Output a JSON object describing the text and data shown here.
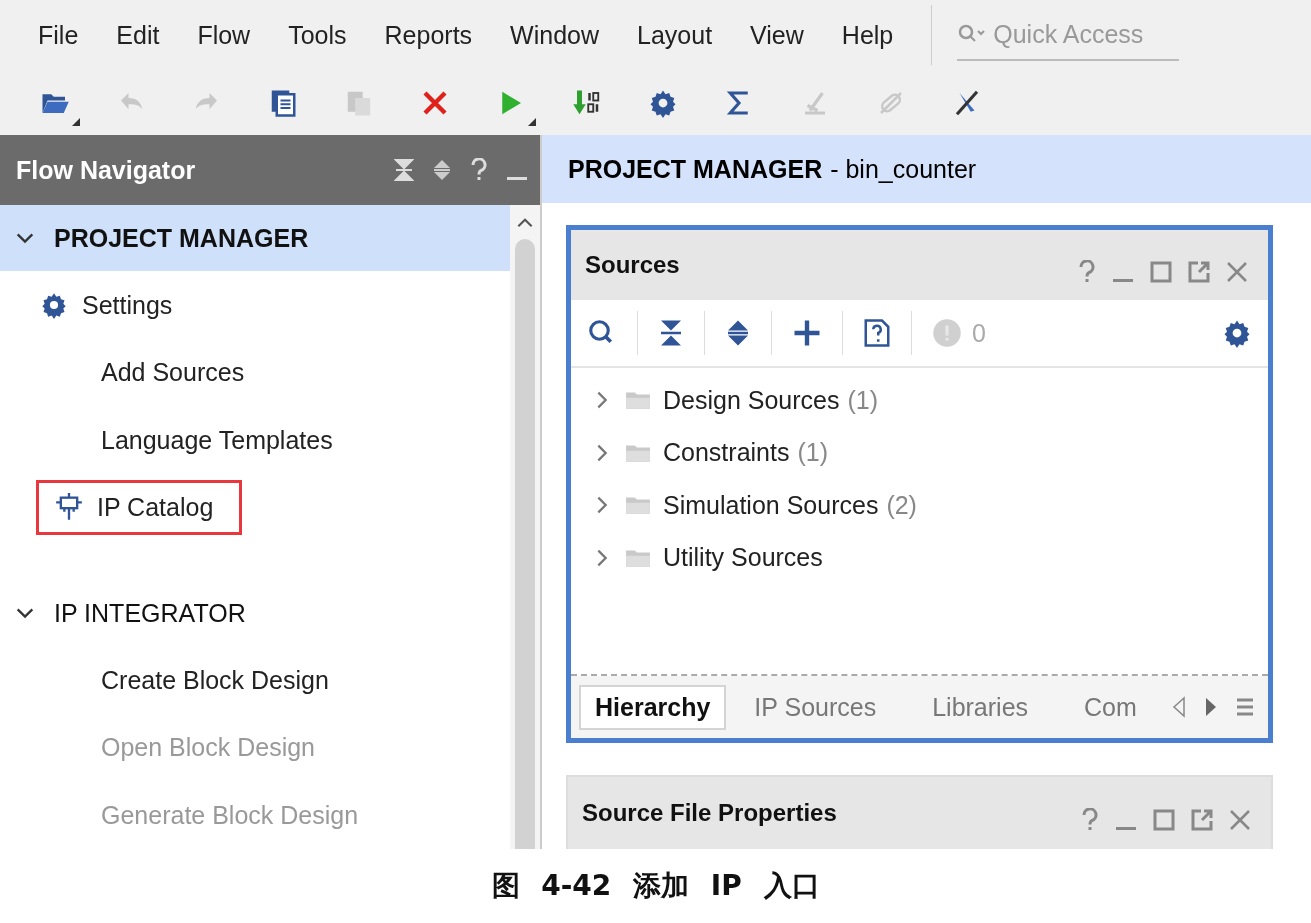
{
  "menu": [
    {
      "label": "File"
    },
    {
      "label": "Edit"
    },
    {
      "label": "Flow"
    },
    {
      "label": "Tools"
    },
    {
      "label": "Reports"
    },
    {
      "label": "Window"
    },
    {
      "label": "Layout"
    },
    {
      "label": "View"
    },
    {
      "label": "Help"
    }
  ],
  "quick_access": {
    "placeholder": "Quick Access"
  },
  "toolbar": [
    {
      "kind": "open",
      "disabled": false,
      "dropdown": true
    },
    {
      "kind": "undo",
      "disabled": true
    },
    {
      "kind": "redo",
      "disabled": true
    },
    {
      "kind": "report",
      "disabled": false
    },
    {
      "kind": "paste",
      "disabled": true
    },
    {
      "kind": "stop",
      "disabled": false
    },
    {
      "kind": "run",
      "disabled": false,
      "dropdown": true
    },
    {
      "kind": "bitstream",
      "disabled": false
    },
    {
      "kind": "settings",
      "disabled": false
    },
    {
      "kind": "sigma",
      "disabled": false
    },
    {
      "kind": "probe",
      "disabled": true
    },
    {
      "kind": "link",
      "disabled": true
    },
    {
      "kind": "tool",
      "disabled": false
    }
  ],
  "flow_navigator": {
    "title": "Flow Navigator",
    "sections": [
      {
        "label": "PROJECT MANAGER",
        "expanded": true,
        "selected": true,
        "bold": true,
        "children": [
          {
            "label": "Settings",
            "kind": "gear",
            "disabled": false,
            "highlighted": false
          },
          {
            "label": "Add Sources",
            "disabled": false,
            "highlighted": false
          },
          {
            "label": "Language Templates",
            "disabled": false,
            "highlighted": false
          },
          {
            "label": "IP Catalog",
            "kind": "chip",
            "disabled": false,
            "highlighted": true
          }
        ]
      },
      {
        "label": "IP INTEGRATOR",
        "expanded": true,
        "selected": false,
        "bold": false,
        "children": [
          {
            "label": "Create Block Design",
            "disabled": false,
            "highlighted": false
          },
          {
            "label": "Open Block Design",
            "disabled": true,
            "highlighted": false
          },
          {
            "label": "Generate Block Design",
            "disabled": true,
            "highlighted": false
          }
        ]
      }
    ]
  },
  "main_header": {
    "title": "PROJECT MANAGER",
    "subtitle": "- bin_counter"
  },
  "sources": {
    "title": "Sources",
    "warning_count": "0",
    "tree": [
      {
        "label": "Design Sources",
        "count": "(1)",
        "expanded": false
      },
      {
        "label": "Constraints",
        "count": "(1)",
        "expanded": false
      },
      {
        "label": "Simulation Sources",
        "count": "(2)",
        "expanded": false
      },
      {
        "label": "Utility Sources",
        "expanded": false
      }
    ],
    "tabs": [
      {
        "label": "Hierarchy",
        "selected": true
      },
      {
        "label": "IP Sources",
        "selected": false
      },
      {
        "label": "Libraries",
        "selected": false
      },
      {
        "label": "Com",
        "selected": false
      }
    ]
  },
  "properties": {
    "title": "Source File Properties"
  },
  "caption": "图 4-42 添加 IP 入口"
}
